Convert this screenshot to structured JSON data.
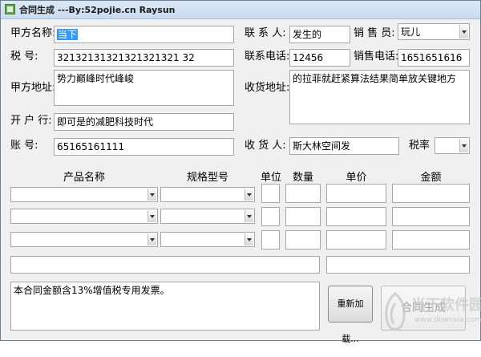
{
  "window": {
    "title": "合同生成 ---By:52pojie.cn Raysun"
  },
  "labels": {
    "party_a_name": "甲方名称:",
    "tax_no": "税      号:",
    "party_a_address": "甲方地址:",
    "bank": "开 户 行:",
    "account": "账      号:",
    "contact": "联 系 人:",
    "contact_phone": "联系电话:",
    "receive_address": "收货地址:",
    "receiver": "收 货 人:",
    "salesperson": "销 售 员:",
    "sales_phone": "销售电话:",
    "tax_rate": "税率"
  },
  "fields": {
    "party_a_name": "当下",
    "tax_no": "32132131321321321321 32",
    "party_a_address": "势力巅峰时代峰峻",
    "bank": "即可是的减肥科技时代",
    "account": "65165161111",
    "contact": "发生的",
    "contact_phone": "12456",
    "receive_address": "的拉菲就赶紧算法结果简单放关键地方",
    "receiver": "斯大林空间发",
    "salesperson": "玩儿",
    "sales_phone": "1651651616",
    "tax_rate": ""
  },
  "table": {
    "headers": [
      "产品名称",
      "规格型号",
      "单位",
      "数量",
      "单价",
      "金额"
    ],
    "rows": [
      {
        "product": "",
        "spec": "",
        "unit": "",
        "qty": "",
        "price": "",
        "amount": ""
      },
      {
        "product": "",
        "spec": "",
        "unit": "",
        "qty": "",
        "price": "",
        "amount": ""
      },
      {
        "product": "",
        "spec": "",
        "unit": "",
        "qty": "",
        "price": "",
        "amount": ""
      }
    ],
    "total_words": "",
    "total_amount": ""
  },
  "notes": "本合同金额含13%增值税专用发票。",
  "buttons": {
    "reload": "重新加载...",
    "generate": "合同生成"
  },
  "watermark": {
    "brand": "当下软件园",
    "url": "www.downxia.com"
  },
  "colors": {
    "selection": "#3399ff",
    "window_bg": "#f0f0f0"
  }
}
